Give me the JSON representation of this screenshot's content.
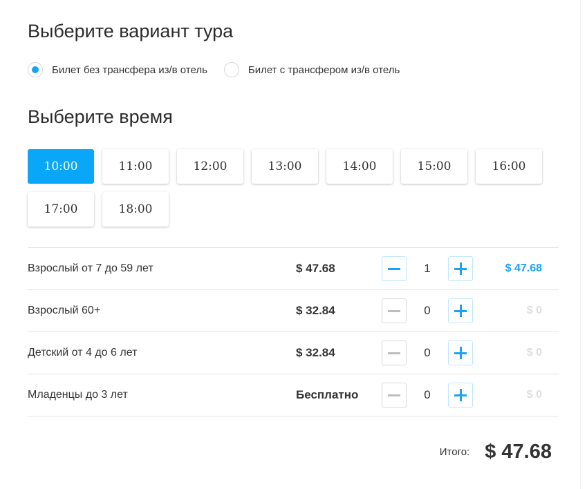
{
  "tour": {
    "title": "Выберите вариант тура",
    "options": [
      {
        "label": "Билет без трансфера из/в отель",
        "selected": true
      },
      {
        "label": "Билет с трансфером из/в отель",
        "selected": false
      }
    ]
  },
  "time": {
    "title": "Выберите время",
    "slots": [
      "10:00",
      "11:00",
      "12:00",
      "13:00",
      "14:00",
      "15:00",
      "16:00",
      "17:00",
      "18:00"
    ],
    "selected": "10:00"
  },
  "tickets": [
    {
      "name": "Взрослый от 7 до 59 лет",
      "price": "$ 47.68",
      "qty": "1",
      "total": "$ 47.68"
    },
    {
      "name": "Взрослый 60+",
      "price": "$ 32.84",
      "qty": "0",
      "total": "$ 0"
    },
    {
      "name": "Детский от 4 до 6 лет",
      "price": "$ 32.84",
      "qty": "0",
      "total": "$ 0"
    },
    {
      "name": "Младенцы до 3 лет",
      "price": "Бесплатно",
      "qty": "0",
      "total": "$ 0"
    }
  ],
  "summary": {
    "label": "Итого:",
    "total": "$ 47.68"
  },
  "colors": {
    "accent": "#0aa6f7",
    "inactive_total": "#dedede"
  },
  "icons": {
    "minus": "minus-icon",
    "plus": "plus-icon"
  }
}
